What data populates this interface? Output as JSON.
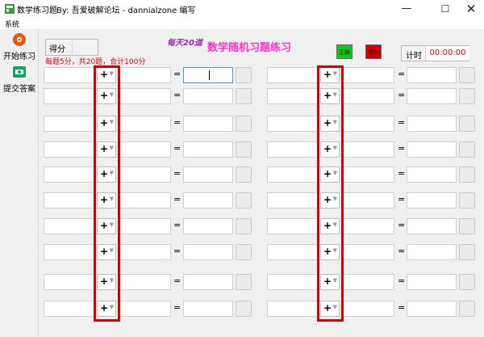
{
  "window": {
    "title": "数学练习题",
    "author": "By: 吾爱破解论坛 - dannialzone 编写",
    "minimize": "—",
    "maximize": "☐",
    "close": "✕"
  },
  "menu": {
    "items": [
      "系统"
    ]
  },
  "toolbar": [
    {
      "label": "开始练习",
      "icon": "start-icon"
    },
    {
      "label": "提交答案",
      "icon": "submit-icon"
    }
  ],
  "score": {
    "label": "得分",
    "value": ""
  },
  "rules": "每题5分，共20题，合计100分",
  "daily": "每天20道",
  "main_title": "数学随机习题练习",
  "legend": {
    "correct": "正确",
    "wrong": "错误"
  },
  "timer": {
    "label": "计时",
    "value": "00:00:00"
  },
  "questions": {
    "operator": "+",
    "equals": "=",
    "left": [
      {
        "a": "",
        "b": "",
        "answer": ""
      },
      {
        "a": "",
        "b": "",
        "answer": ""
      },
      {
        "a": "",
        "b": "",
        "answer": ""
      },
      {
        "a": "",
        "b": "",
        "answer": ""
      },
      {
        "a": "",
        "b": "",
        "answer": ""
      },
      {
        "a": "",
        "b": "",
        "answer": ""
      },
      {
        "a": "",
        "b": "",
        "answer": ""
      },
      {
        "a": "",
        "b": "",
        "answer": ""
      },
      {
        "a": "",
        "b": "",
        "answer": ""
      },
      {
        "a": "",
        "b": "",
        "answer": ""
      }
    ],
    "right": [
      {
        "a": "",
        "b": "",
        "answer": ""
      },
      {
        "a": "",
        "b": "",
        "answer": ""
      },
      {
        "a": "",
        "b": "",
        "answer": ""
      },
      {
        "a": "",
        "b": "",
        "answer": ""
      },
      {
        "a": "",
        "b": "",
        "answer": ""
      },
      {
        "a": "",
        "b": "",
        "answer": ""
      },
      {
        "a": "",
        "b": "",
        "answer": ""
      },
      {
        "a": "",
        "b": "",
        "answer": ""
      },
      {
        "a": "",
        "b": "",
        "answer": ""
      },
      {
        "a": "",
        "b": "",
        "answer": ""
      }
    ]
  },
  "colors": {
    "title_accent": "#ff33cc",
    "daily_accent": "#9c27b0",
    "rules_red": "#e60000",
    "correct_green": "#1cc21c",
    "wrong_red": "#d30000",
    "highlight_red": "#d50000"
  }
}
